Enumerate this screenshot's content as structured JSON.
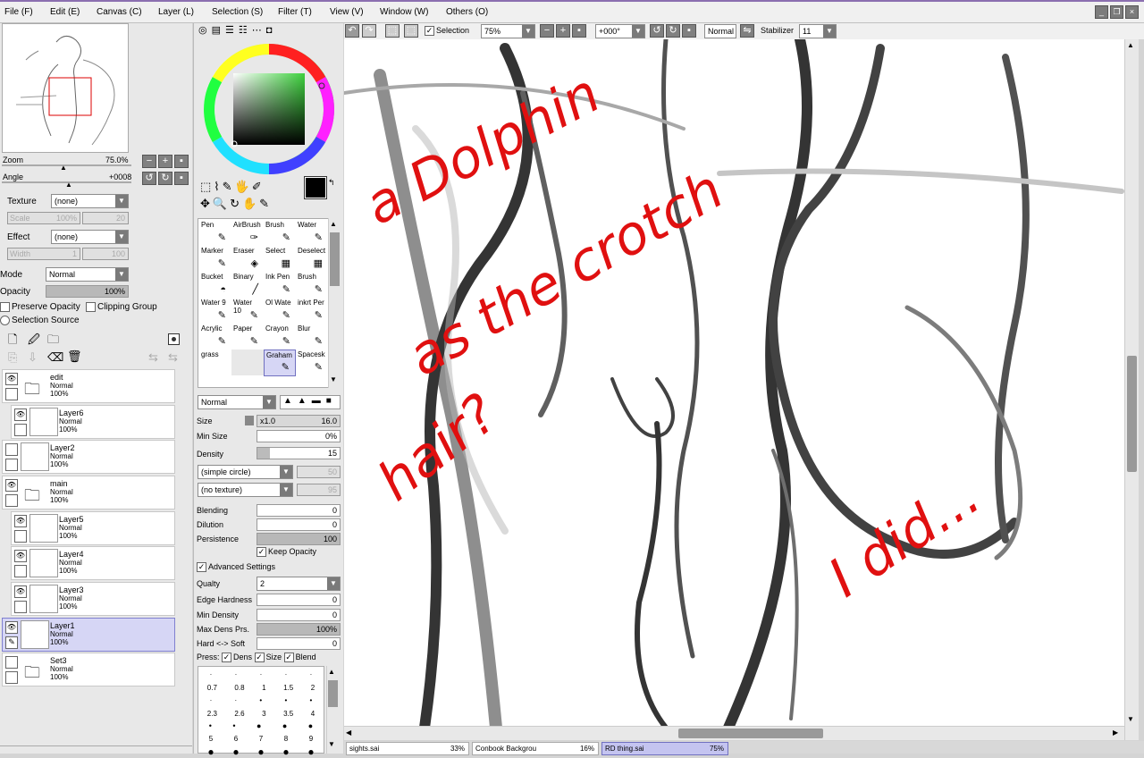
{
  "menu": [
    "File (F)",
    "Edit (E)",
    "Canvas (C)",
    "Layer (L)",
    "Selection (S)",
    "Filter (T)",
    "View (V)",
    "Window (W)",
    "Others (O)"
  ],
  "navigator": {
    "zoom_label": "Zoom",
    "zoom_value": "75.0%",
    "angle_label": "Angle",
    "angle_value": "+0008"
  },
  "texture": {
    "label": "Texture",
    "value": "(none)",
    "scale_label": "Scale",
    "scale_value": "100%",
    "scale_num": "20"
  },
  "effect": {
    "label": "Effect",
    "value": "(none)",
    "width_label": "Width",
    "width_value": "1",
    "width_num": "100"
  },
  "blend": {
    "mode_label": "Mode",
    "mode_value": "Normal",
    "opacity_label": "Opacity",
    "opacity_value": "100%",
    "preserve": "Preserve Opacity",
    "clipping": "Clipping Group",
    "selsource": "Selection Source"
  },
  "layers": [
    {
      "name": "edit",
      "mode": "Normal",
      "opacity": "100%",
      "folder": true
    },
    {
      "name": "Layer6",
      "mode": "Normal",
      "opacity": "100%",
      "folder": false
    },
    {
      "name": "Layer2",
      "mode": "Normal",
      "opacity": "100%",
      "folder": false
    },
    {
      "name": "main",
      "mode": "Normal",
      "opacity": "100%",
      "folder": true
    },
    {
      "name": "Layer5",
      "mode": "Normal",
      "opacity": "100%",
      "folder": false
    },
    {
      "name": "Layer4",
      "mode": "Normal",
      "opacity": "100%",
      "folder": false
    },
    {
      "name": "Layer3",
      "mode": "Normal",
      "opacity": "100%",
      "folder": false
    },
    {
      "name": "Layer1",
      "mode": "Normal",
      "opacity": "100%",
      "folder": false
    },
    {
      "name": "Set3",
      "mode": "Normal",
      "opacity": "100%",
      "folder": true
    }
  ],
  "tools": [
    [
      "Pen",
      "AirBrush",
      "Brush",
      "Water"
    ],
    [
      "Marker",
      "Eraser",
      "Select",
      "Deselect"
    ],
    [
      "Bucket",
      "Binary",
      "Ink Pen",
      "Brush"
    ],
    [
      "Water 9",
      "Water 10",
      "Ol Wate",
      "inkrt Per"
    ],
    [
      "Acrylic",
      "Paper",
      "Crayon",
      "Blur"
    ],
    [
      "grass",
      "",
      "Graham",
      "Spacesk"
    ]
  ],
  "brush": {
    "mode": "Normal",
    "size_label": "Size",
    "size_mult": "x1.0",
    "size_value": "16.0",
    "minsize_label": "Min Size",
    "minsize_value": "0%",
    "density_label": "Density",
    "density_value": "15",
    "shape": "(simple circle)",
    "shape_num": "50",
    "tex": "(no texture)",
    "tex_num": "95",
    "blending_label": "Blending",
    "blending_value": "0",
    "dilution_label": "Dilution",
    "dilution_value": "0",
    "persistence_label": "Persistence",
    "persistence_value": "100",
    "keep_opacity": "Keep Opacity",
    "advanced": "Advanced Settings",
    "quality_label": "Qualty",
    "quality_value": "2",
    "edge_label": "Edge Hardness",
    "edge_value": "0",
    "mindens_label": "Min Density",
    "mindens_value": "0",
    "maxdens_label": "Max Dens Prs.",
    "maxdens_value": "100%",
    "hardsoft_label": "Hard <-> Soft",
    "hardsoft_value": "0",
    "press_label": "Press:",
    "press_dens": "Dens",
    "press_size": "Size",
    "press_blend": "Blend",
    "sizes_row1": [
      "0.7",
      "0.8",
      "1",
      "1.5",
      "2"
    ],
    "sizes_row2": [
      "2.3",
      "2.6",
      "3",
      "3.5",
      "4"
    ],
    "sizes_row3": [
      "5",
      "6",
      "7",
      "8",
      "9"
    ]
  },
  "toolbar": {
    "selection": "Selection",
    "zoom": "75%",
    "angle": "+000°",
    "mode": "Normal",
    "stabilizer_label": "Stabilizer",
    "stabilizer_value": "11"
  },
  "annotations": {
    "line1": "a Dolphin",
    "line2": "as the crotch",
    "line3": "hair?",
    "line4": "I did...",
    "color": "#e01010"
  },
  "tabs": [
    {
      "name": "sights.sai",
      "zoom": "33%"
    },
    {
      "name": "Conbook Backgrou",
      "zoom": "16%"
    },
    {
      "name": "RD thing.sai",
      "zoom": "75%"
    }
  ],
  "colors": {
    "primary": "#000000",
    "secondary": "#5ad8e0",
    "selected_layer": "#d6d6f5"
  }
}
